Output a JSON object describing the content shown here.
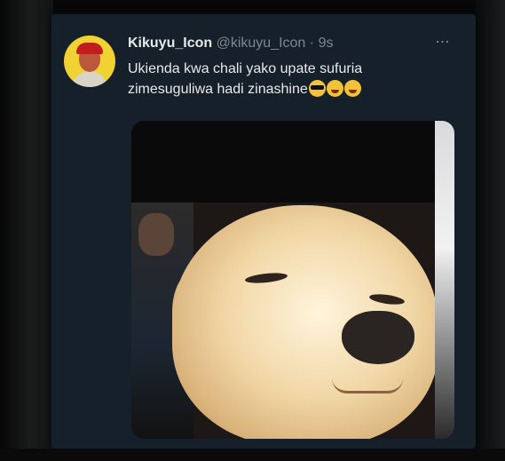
{
  "tweet": {
    "display_name": "Kikuyu_Icon",
    "handle": "@kikuyu_Icon",
    "separator": "·",
    "time": "9s",
    "more_icon": "⋯",
    "text": "Ukienda kwa chali yako upate sufuria zimesuguliwa hadi zinashine",
    "emojis": [
      "smiling-face-with-sunglasses",
      "face-with-tears-of-joy",
      "face-with-tears-of-joy"
    ]
  },
  "colors": {
    "card_background": "#16202b",
    "avatar_background": "#f0d233",
    "primary_text": "#e7e9ea",
    "secondary_text": "#7c8791"
  }
}
